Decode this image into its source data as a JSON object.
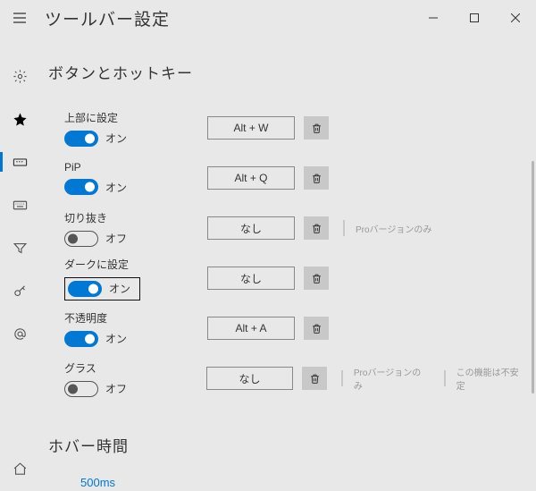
{
  "title": "ツールバー設定",
  "section_buttons": "ボタンとホットキー",
  "section_hover": "ホバー時間",
  "state_on": "オン",
  "state_off": "オフ",
  "items": [
    {
      "label": "上部に設定",
      "on": true,
      "hotkey": "Alt + W",
      "notes": []
    },
    {
      "label": "PiP",
      "on": true,
      "hotkey": "Alt + Q",
      "notes": []
    },
    {
      "label": "切り抜き",
      "on": false,
      "hotkey": "なし",
      "notes": [
        "Proバージョンのみ"
      ]
    },
    {
      "label": "ダークに設定",
      "on": true,
      "hotkey": "なし",
      "notes": [],
      "boxed": true
    },
    {
      "label": "不透明度",
      "on": true,
      "hotkey": "Alt + A",
      "notes": []
    },
    {
      "label": "グラス",
      "on": false,
      "hotkey": "なし",
      "notes": [
        "Proバージョンのみ",
        "この機能は不安定"
      ]
    }
  ],
  "hover_value": "500ms"
}
